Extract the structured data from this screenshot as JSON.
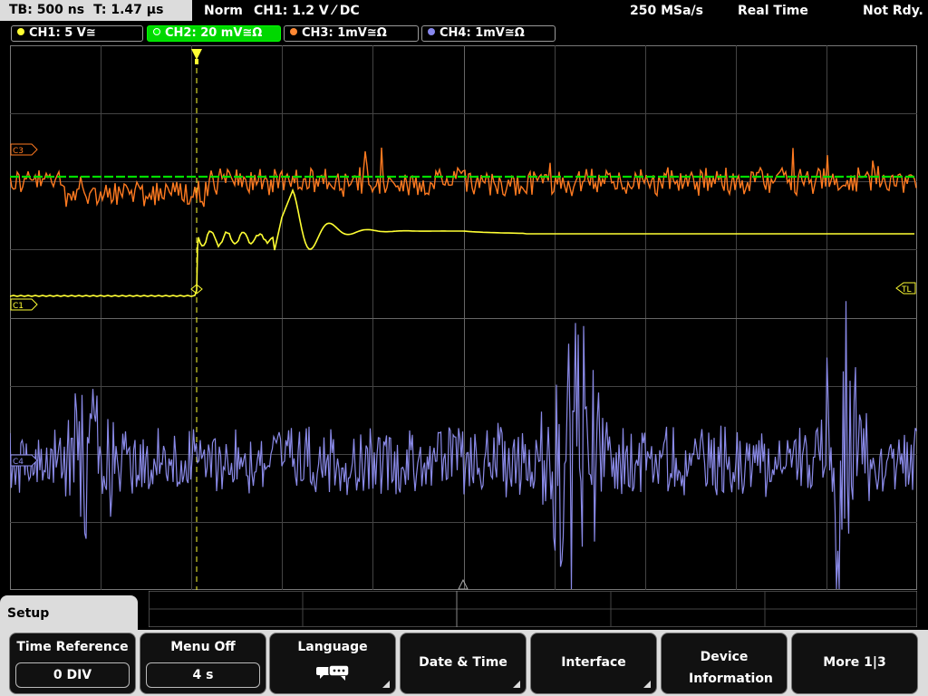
{
  "status_bar": {
    "timebase": "TB: 500 ns",
    "trigger_time": "T: 1.47 µs",
    "trigger_mode": "Norm",
    "trigger_source": "CH1: 1.2 V ⁄ DC",
    "sample_rate": "250 MSa/s",
    "acquisition": "Real Time",
    "ready_state": "Not Rdy."
  },
  "channels": [
    {
      "label": "CH1: 5 V≅",
      "color": "#ffff33"
    },
    {
      "label": "CH2: 20 mV≅Ω",
      "color": "#00ff00",
      "active": true
    },
    {
      "label": "CH3: 1mV≅Ω",
      "color": "#ff8833"
    },
    {
      "label": "CH4: 1mV≅Ω",
      "color": "#8888ee"
    }
  ],
  "markers": {
    "c3": "C3",
    "c1": "C1",
    "c4": "C4",
    "trigger_level": "TL"
  },
  "colors": {
    "ch1": "#ffff33",
    "ch2": "#00dd00",
    "ch3": "#ff7a20",
    "ch4": "#8a8ae8",
    "grid": "#444444"
  },
  "menu": {
    "tab": "Setup",
    "buttons": [
      {
        "label": "Time Reference",
        "value": "0 DIV"
      },
      {
        "label": "Menu Off",
        "value": "4 s"
      },
      {
        "label": "Language",
        "icon": "speech-bubble-icon"
      },
      {
        "label": "Date & Time"
      },
      {
        "label": "Interface"
      },
      {
        "label": "Device Information"
      },
      {
        "label": "More 1|3"
      }
    ]
  }
}
